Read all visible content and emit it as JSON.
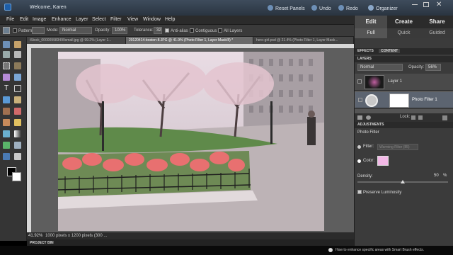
{
  "titlebar": {
    "welcome": "Welcome, Karen",
    "reset_panels": "Reset Panels",
    "undo": "Undo",
    "redo": "Redo",
    "organizer": "Organizer"
  },
  "menu": [
    "File",
    "Edit",
    "Image",
    "Enhance",
    "Layer",
    "Select",
    "Filter",
    "View",
    "Window",
    "Help"
  ],
  "options": {
    "pattern": "Pattern",
    "mode_label": "Mode:",
    "mode_value": "Normal",
    "opacity_label": "Opacity:",
    "opacity_value": "100%",
    "tolerance_label": "Tolerance:",
    "tolerance_value": "32",
    "anti_alias": "Anti-alias",
    "contiguous": "Contiguous",
    "all_layers": "All Layers"
  },
  "tabs": [
    "iStock_000009983499small.jpg @ 99.2% (Layer 1...",
    "20120414-boston-8.JPG @ 41.9% (Photo Filter 1, Layer Mask/8) *",
    "hero-girl.psd @ 21.4% (Photo Filter 1, Layer Mask..."
  ],
  "status": {
    "zoom": "41.92%",
    "doc_info": "1000 pixels x 1200 pixels (300 ..."
  },
  "project_bin": "PROJECT BIN",
  "panel": {
    "tabs": [
      "Edit",
      "Create",
      "Share"
    ],
    "subtabs": [
      "Full",
      "Quick",
      "Guided"
    ],
    "sections": [
      "EFFECTS",
      "CONTENT"
    ],
    "layers_header": "LAYERS",
    "blend_mode": "Normal",
    "opacity_label": "Opacity:",
    "opacity_value": "56%",
    "layers": [
      {
        "name": "Layer 1"
      },
      {
        "name": "Photo Filter 1"
      }
    ],
    "lock_label": "Lock:",
    "adjustments_header": "ADJUSTMENTS",
    "adjustment_name": "Photo Filter",
    "filter_label": "Filter:",
    "filter_value": "Warming Filter (85)",
    "color_label": "Color:",
    "color_value": "#f2b8e6",
    "density_label": "Density:",
    "density_value": "50",
    "density_unit": "%",
    "density_level": 0.5,
    "preserve": "Preserve Luminosity"
  },
  "hint": "How to enhance specific areas with Smart Brush effects."
}
